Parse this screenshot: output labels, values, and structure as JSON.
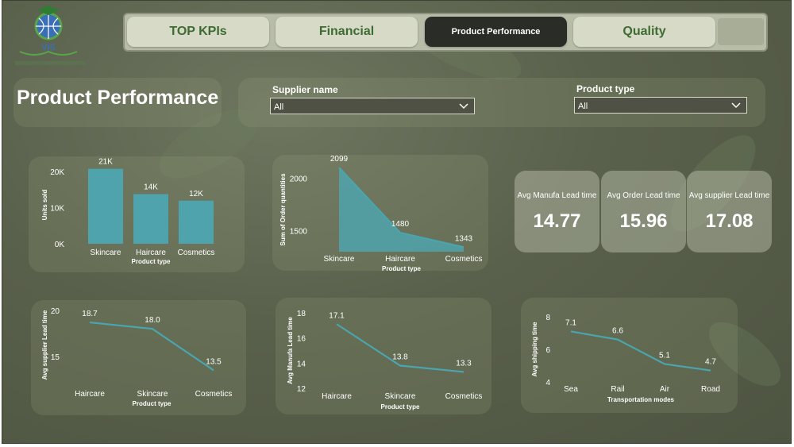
{
  "nav": {
    "tabs": [
      {
        "label": "TOP KPIs",
        "active": false
      },
      {
        "label": "Financial",
        "active": false
      },
      {
        "label": "Product Performance",
        "active": true
      },
      {
        "label": "Quality",
        "active": false
      }
    ]
  },
  "page": {
    "title": "Product Performance"
  },
  "filters": {
    "supplier": {
      "label": "Supplier name",
      "value": "All"
    },
    "product_type": {
      "label": "Product type",
      "value": "All"
    }
  },
  "kpis": [
    {
      "label": "Avg Manufa Lead time",
      "value": "14.77"
    },
    {
      "label": "Avg Order Lead time",
      "value": "15.96"
    },
    {
      "label": "Avg supplier Lead time",
      "value": "17.08"
    }
  ],
  "colors": {
    "accent": "#4fa3ac",
    "line": "#4aa5ae",
    "tab_bg": "#d6dac6",
    "tab_text": "#3e6b33"
  },
  "chart_data": [
    {
      "id": "units",
      "type": "bar",
      "categories": [
        "Skincare",
        "Haircare",
        "Cosmetics"
      ],
      "values": [
        20700,
        13700,
        11900
      ],
      "data_labels": [
        "21K",
        "14K",
        "12K"
      ],
      "ytick_labels": [
        "0K",
        "10K",
        "20K"
      ],
      "yticks": [
        0,
        10000,
        20000
      ],
      "xlabel": "Product type",
      "ylabel": "Units sold",
      "ylim": [
        0,
        21500
      ]
    },
    {
      "id": "orders",
      "type": "area",
      "categories": [
        "Skincare",
        "Haircare",
        "Cosmetics"
      ],
      "values": [
        2099,
        1480,
        1343
      ],
      "data_labels": [
        "2099",
        "1480",
        "1343"
      ],
      "yticks": [
        1500,
        2000
      ],
      "ytick_labels": [
        "1500",
        "2000"
      ],
      "xlabel": "Product type",
      "ylabel": "Sum of Order quantities",
      "ylim": [
        1300,
        2100
      ]
    },
    {
      "id": "supplier_lead",
      "type": "line",
      "categories": [
        "Haircare",
        "Skincare",
        "Cosmetics"
      ],
      "values": [
        18.7,
        18.0,
        13.5
      ],
      "data_labels": [
        "18.7",
        "18.0",
        "13.5"
      ],
      "yticks": [
        15,
        20
      ],
      "ytick_labels": [
        "15",
        "20"
      ],
      "xlabel": "Product type",
      "ylabel": "Avg supplier Lead time",
      "ylim": [
        12.5,
        20
      ]
    },
    {
      "id": "manufa_lead",
      "type": "line",
      "categories": [
        "Haircare",
        "Skincare",
        "Cosmetics"
      ],
      "values": [
        17.1,
        13.8,
        13.3
      ],
      "data_labels": [
        "17.1",
        "13.8",
        "13.3"
      ],
      "yticks": [
        12,
        14,
        16,
        18
      ],
      "ytick_labels": [
        "12",
        "14",
        "16",
        "18"
      ],
      "xlabel": "Product type",
      "ylabel": "Avg Manufa Lead time",
      "ylim": [
        12,
        18
      ]
    },
    {
      "id": "shipping",
      "type": "line",
      "categories": [
        "Sea",
        "Rail",
        "Air",
        "Road"
      ],
      "values": [
        7.1,
        6.6,
        5.1,
        4.7
      ],
      "data_labels": [
        "7.1",
        "6.6",
        "5.1",
        "4.7"
      ],
      "yticks": [
        4,
        6,
        8
      ],
      "ytick_labels": [
        "4",
        "6",
        "8"
      ],
      "xlabel": "Transportation modes",
      "ylabel": "Avg shipping time",
      "ylim": [
        4,
        8
      ]
    }
  ]
}
